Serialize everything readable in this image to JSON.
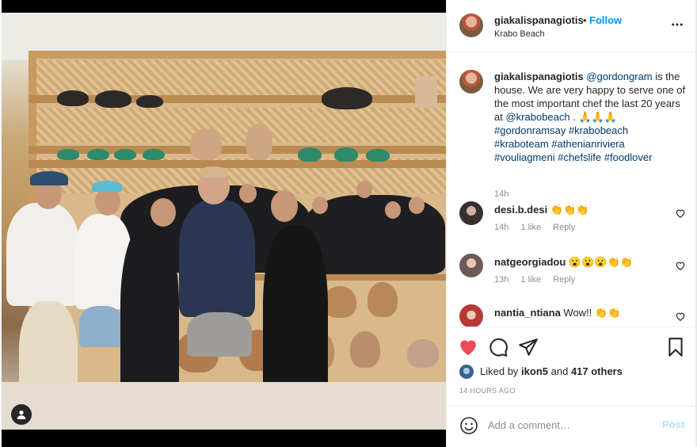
{
  "post": {
    "username": "giakalispanagiotis",
    "dot": "•",
    "follow_label": "Follow",
    "location": "Krabo Beach",
    "more_icon": "more-horizontal-icon"
  },
  "caption": {
    "username": "giakalispanagiotis",
    "mention1": "@gordongram",
    "text1": " is the house. We are very happy to serve one of the most important chef the last 20 years at ",
    "mention2": "@krabobeach",
    "text2": " . 🙏🙏🙏",
    "hashtags_line1": "#gordonramsay #krabobeach",
    "hashtags_line2": "#kraboteam #athenianriviera",
    "hashtags_line3": "#vouliagmeni #chefslife #foodlover",
    "time": "14h"
  },
  "comments": [
    {
      "username": "desi.b.desi",
      "text": "👏👏👏",
      "time": "14h",
      "likes": "1 like",
      "reply": "Reply"
    },
    {
      "username": "natgeorgiadou",
      "text": "😮😮😮👏👏",
      "time": "13h",
      "likes": "1 like",
      "reply": "Reply"
    },
    {
      "username": "nantia_ntiana",
      "text": "Wow!! 👏👏",
      "time": "",
      "likes": "",
      "reply": ""
    }
  ],
  "likes": {
    "prefix": "Liked by ",
    "user": "ikon5",
    "middle": " and ",
    "count": "417 others"
  },
  "posted_ago": "14 HOURS AGO",
  "add_comment": {
    "placeholder": "Add a comment…",
    "post_label": "Post"
  },
  "colors": {
    "like_active": "#ed4956",
    "link": "#00376b",
    "follow": "#0095f6",
    "post_disabled": "#b2dffc"
  }
}
